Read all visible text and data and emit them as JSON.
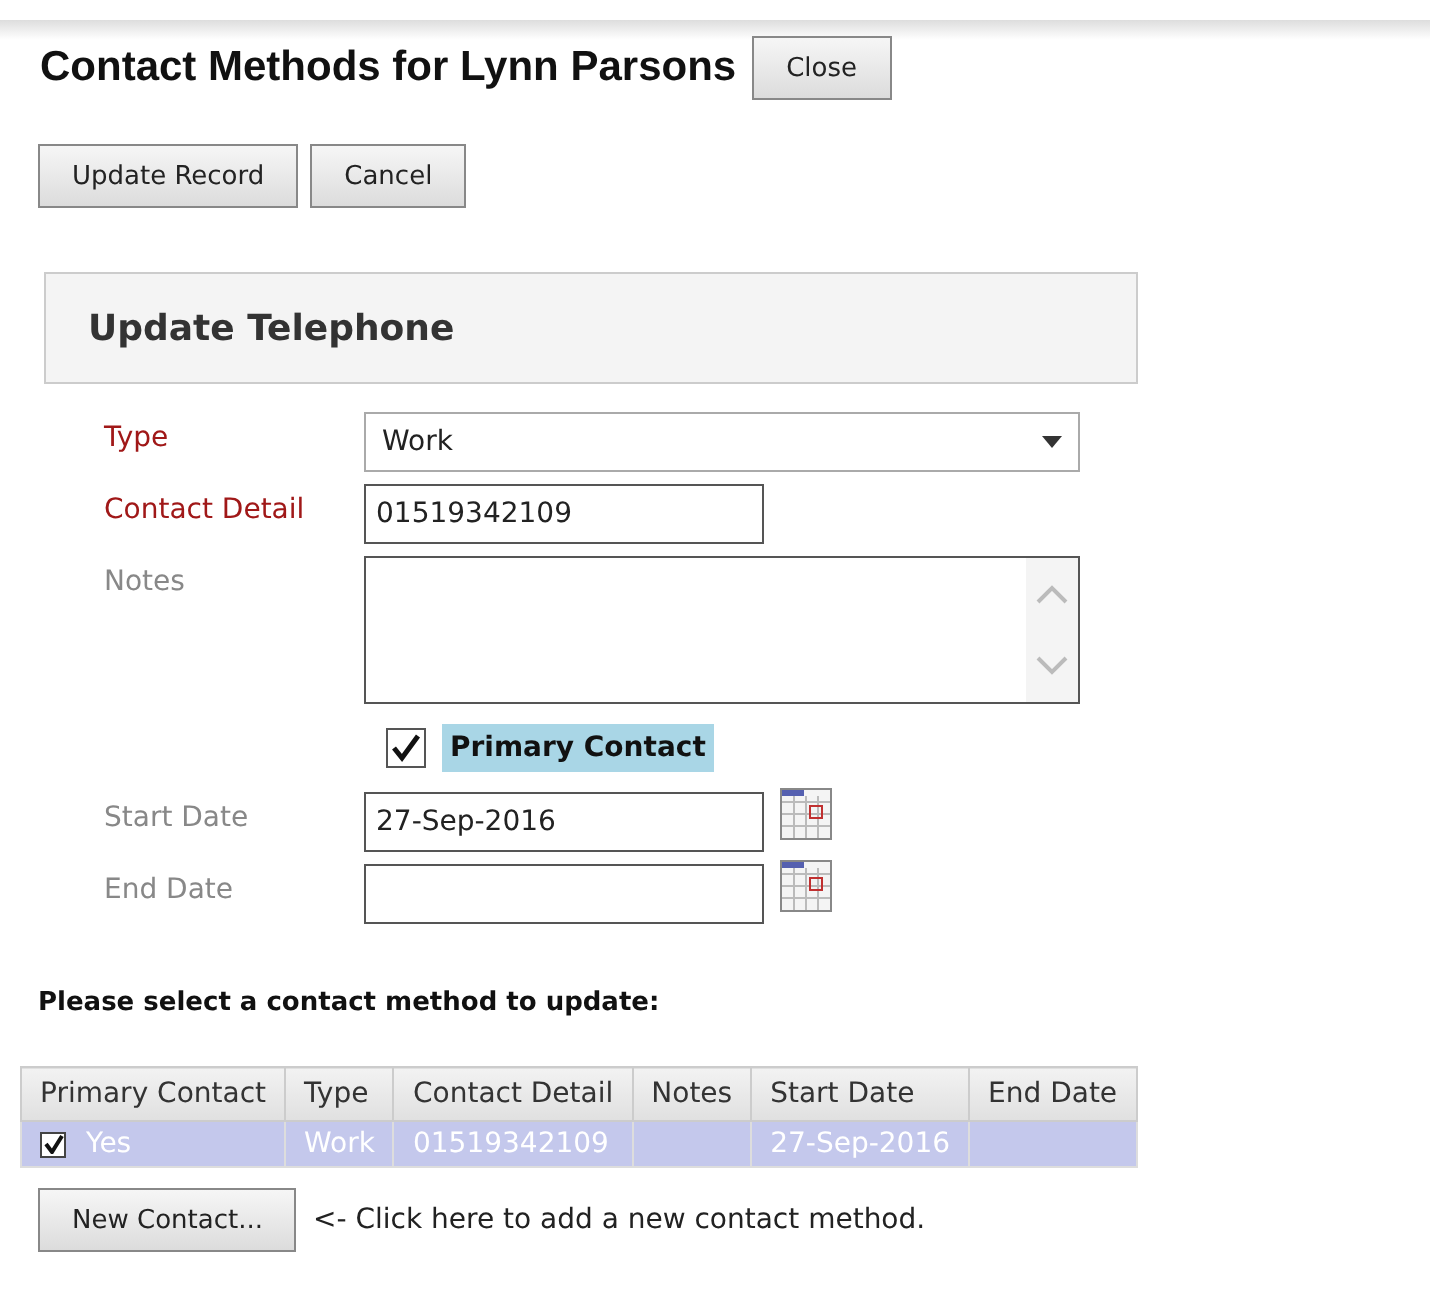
{
  "title": "Contact Methods for Lynn Parsons",
  "close_button": "Close",
  "actions": [
    "Update Record",
    "Cancel"
  ],
  "panel": {
    "title": "Update Telephone"
  },
  "form": {
    "fields": [
      {
        "kind": "select",
        "label": "Type",
        "required": true,
        "value": "Work"
      },
      {
        "kind": "text",
        "label": "Contact Detail",
        "required": true,
        "value": "01519342109"
      },
      {
        "kind": "textarea",
        "label": "Notes",
        "required": false
      },
      {
        "kind": "checkbox",
        "label": "Primary Contact",
        "checked": true
      },
      {
        "kind": "date",
        "label": "Start Date",
        "required": false,
        "value": "27-Sep-2016"
      },
      {
        "kind": "date",
        "label": "End Date",
        "required": false
      }
    ]
  },
  "list_heading": "Please select a contact method to update:",
  "table": {
    "columns": [
      "Primary Contact",
      "Type",
      "Contact Detail",
      "Notes",
      "Start Date",
      "End Date"
    ],
    "rows": [
      {
        "selected": true,
        "checked": true,
        "cells": [
          "Yes",
          "Work",
          "01519342109",
          "",
          "27-Sep-2016",
          ""
        ]
      }
    ]
  },
  "new_button": "New Contact...",
  "hint": "<- Click here to add a new contact method."
}
